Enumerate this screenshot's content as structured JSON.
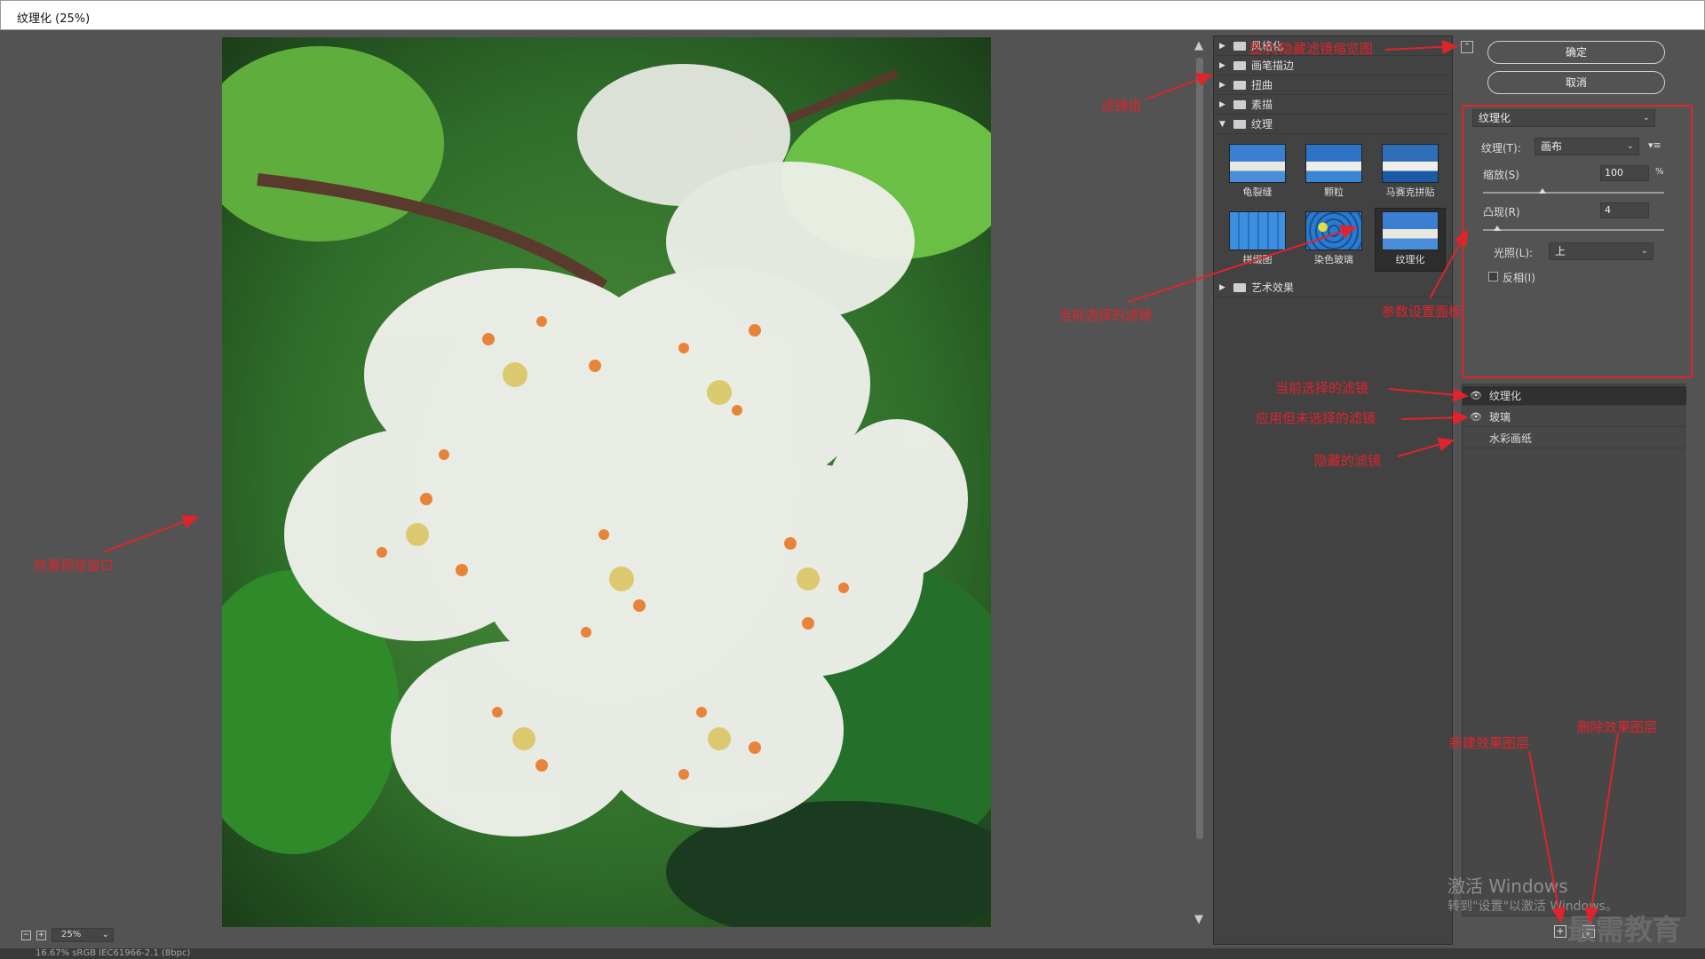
{
  "window": {
    "title": "纹理化 (25%)"
  },
  "zoom": {
    "value": "25%"
  },
  "status": {
    "text": "16.67%    sRGB IEC61966-2.1 (8bpc)"
  },
  "buttons": {
    "ok": "确定",
    "cancel": "取消"
  },
  "filter_groups": [
    {
      "label": "风格化",
      "expanded": false
    },
    {
      "label": "画笔描边",
      "expanded": false
    },
    {
      "label": "扭曲",
      "expanded": false
    },
    {
      "label": "素描",
      "expanded": false
    },
    {
      "label": "纹理",
      "expanded": true
    },
    {
      "label": "艺术效果",
      "expanded": false
    }
  ],
  "texture_filters": [
    {
      "label": "龟裂缝",
      "selected": false
    },
    {
      "label": "颗粒",
      "selected": false
    },
    {
      "label": "马赛克拼贴",
      "selected": false
    },
    {
      "label": "拼缀图",
      "selected": false
    },
    {
      "label": "染色玻璃",
      "selected": false
    },
    {
      "label": "纹理化",
      "selected": true
    }
  ],
  "params": {
    "filter_select": "纹理化",
    "texture_label": "纹理(T):",
    "texture_value": "画布",
    "scale_label": "缩放(S)",
    "scale_value": "100",
    "scale_unit": "%",
    "scale_level": 0.33,
    "relief_label": "凸现(R)",
    "relief_value": "4",
    "relief_level": 0.08,
    "light_label": "光照(L):",
    "light_value": "上",
    "invert_label": "反相(I)",
    "invert_checked": false
  },
  "effect_layers": [
    {
      "name": "纹理化",
      "visible": true,
      "selected": true
    },
    {
      "name": "玻璃",
      "visible": true,
      "selected": false
    },
    {
      "name": "水彩画纸",
      "visible": false,
      "selected": false
    }
  ],
  "annotations": {
    "thumb_toggle": "显示/隐藏滤镜缩览图",
    "filter_group": "滤镜组",
    "current_filter": "当前选择的滤镜",
    "param_panel": "参数设置面板",
    "preview_window": "效果预览窗口",
    "layer_current": "当前选择的滤镜",
    "layer_applied": "应用但未选择的滤镜",
    "layer_hidden": "隐藏的滤镜",
    "new_layer": "新建效果图层",
    "delete_layer": "删除效果图层"
  },
  "watermark": {
    "line1": "激活 Windows",
    "line2": "转到\"设置\"以激活 Windows。",
    "brand": "最需教育"
  },
  "colors": {
    "annotation": "#e0242b",
    "panel_bg": "#535353"
  }
}
